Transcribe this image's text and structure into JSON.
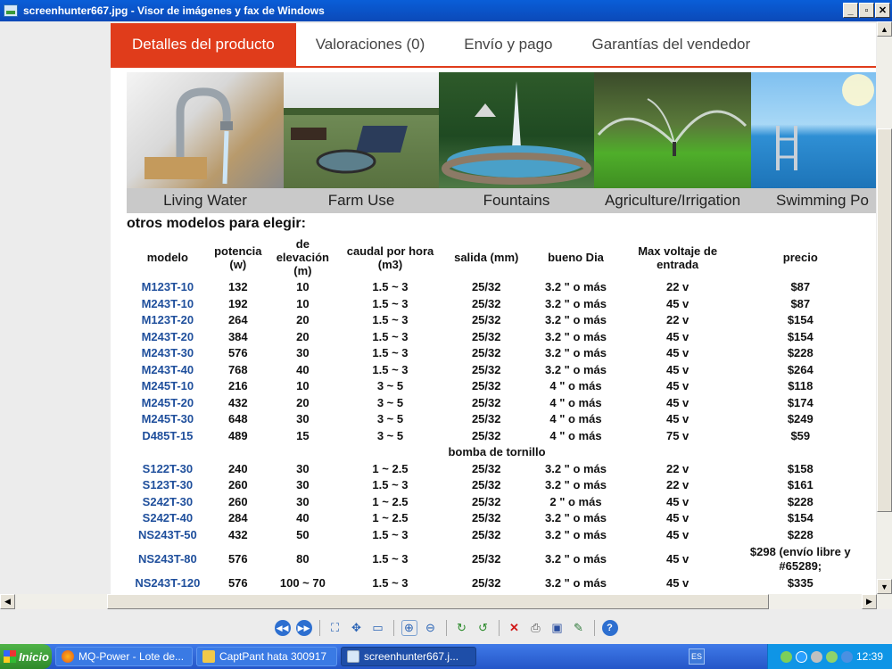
{
  "window": {
    "title": "screenhunter667.jpg - Visor de imágenes y fax de Windows",
    "buttons": [
      "_",
      "▫",
      "✕"
    ]
  },
  "tabs": [
    {
      "label": "Detalles del producto",
      "active": true
    },
    {
      "label": "Valoraciones (0)",
      "active": false
    },
    {
      "label": "Envío y pago",
      "active": false
    },
    {
      "label": "Garantías del vendedor",
      "active": false
    }
  ],
  "photos": [
    {
      "caption": "Living Water"
    },
    {
      "caption": "Farm Use"
    },
    {
      "caption": "Fountains"
    },
    {
      "caption": "Agriculture/Irrigation"
    },
    {
      "caption": "Swimming Po"
    }
  ],
  "heading": "otros modelos para elegir:",
  "table": {
    "headers": [
      "modelo",
      "potencia (w)",
      "de elevación (m)",
      "caudal por hora (m3)",
      "salida (mm)",
      "bueno Dia",
      "Max voltaje de entrada",
      "precio"
    ],
    "rows": [
      [
        "M123T-10",
        "132",
        "10",
        "1.5 ~ 3",
        "25/32",
        "3.2 \" o más",
        "22 v",
        "$87"
      ],
      [
        "M243T-10",
        "192",
        "10",
        "1.5 ~ 3",
        "25/32",
        "3.2 \" o más",
        "45 v",
        "$87"
      ],
      [
        "M123T-20",
        "264",
        "20",
        "1.5 ~ 3",
        "25/32",
        "3.2 \" o más",
        "22 v",
        "$154"
      ],
      [
        "M243T-20",
        "384",
        "20",
        "1.5 ~ 3",
        "25/32",
        "3.2 \" o más",
        "45 v",
        "$154"
      ],
      [
        "M243T-30",
        "576",
        "30",
        "1.5 ~ 3",
        "25/32",
        "3.2 \" o más",
        "45 v",
        "$228"
      ],
      [
        "M243T-40",
        "768",
        "40",
        "1.5 ~ 3",
        "25/32",
        "3.2 \" o más",
        "45 v",
        "$264"
      ],
      [
        "M245T-10",
        "216",
        "10",
        "3 ~ 5",
        "25/32",
        "4 \" o más",
        "45 v",
        "$118"
      ],
      [
        "M245T-20",
        "432",
        "20",
        "3 ~ 5",
        "25/32",
        "4 \" o más",
        "45 v",
        "$174"
      ],
      [
        "M245T-30",
        "648",
        "30",
        "3 ~ 5",
        "25/32",
        "4 \" o más",
        "45 v",
        "$249"
      ],
      [
        "D485T-15",
        "489",
        "15",
        "3 ~ 5",
        "25/32",
        "4 \" o más",
        "75 v",
        "$59"
      ]
    ],
    "section_label": "bomba de tornillo",
    "rows2": [
      [
        "S122T-30",
        "240",
        "30",
        "1 ~ 2.5",
        "25/32",
        "3.2 \" o más",
        "22 v",
        "$158"
      ],
      [
        "S123T-30",
        "260",
        "30",
        "1.5 ~ 3",
        "25/32",
        "3.2 \" o más",
        "22 v",
        "$161"
      ],
      [
        "S242T-30",
        "260",
        "30",
        "1 ~ 2.5",
        "25/32",
        "2 \" o más",
        "45 v",
        "$228"
      ],
      [
        "S242T-40",
        "284",
        "40",
        "1 ~ 2.5",
        "25/32",
        "3.2 \" o más",
        "45 v",
        "$154"
      ],
      [
        "NS243T-50",
        "432",
        "50",
        "1.5 ~ 3",
        "25/32",
        "3.2 \" o más",
        "45 v",
        "$228"
      ],
      [
        "NS243T-80",
        "576",
        "80",
        "1.5 ~ 3",
        "25/32",
        "3.2 \" o más",
        "45 v",
        "$298 (envío libre y #65289;"
      ],
      [
        "NS243T-120",
        "576",
        "100 ~ 70",
        "1.5 ~ 3",
        "25/32",
        "3.2 \" o más",
        "45 v",
        "$335"
      ]
    ]
  },
  "taskbar": {
    "start_label": "Inicio",
    "tasks": [
      {
        "label": "MQ-Power - Lote de...",
        "active": false
      },
      {
        "label": "CaptPant hata 300917",
        "active": false
      },
      {
        "label": "screenhunter667.j...",
        "active": true
      }
    ],
    "lang": "ES",
    "clock": "12:39"
  },
  "colors": {
    "accent": "#e03c1b",
    "model_link": "#1f4f9c",
    "titlebar": "#0b53c8",
    "taskbar": "#2f63d3"
  }
}
